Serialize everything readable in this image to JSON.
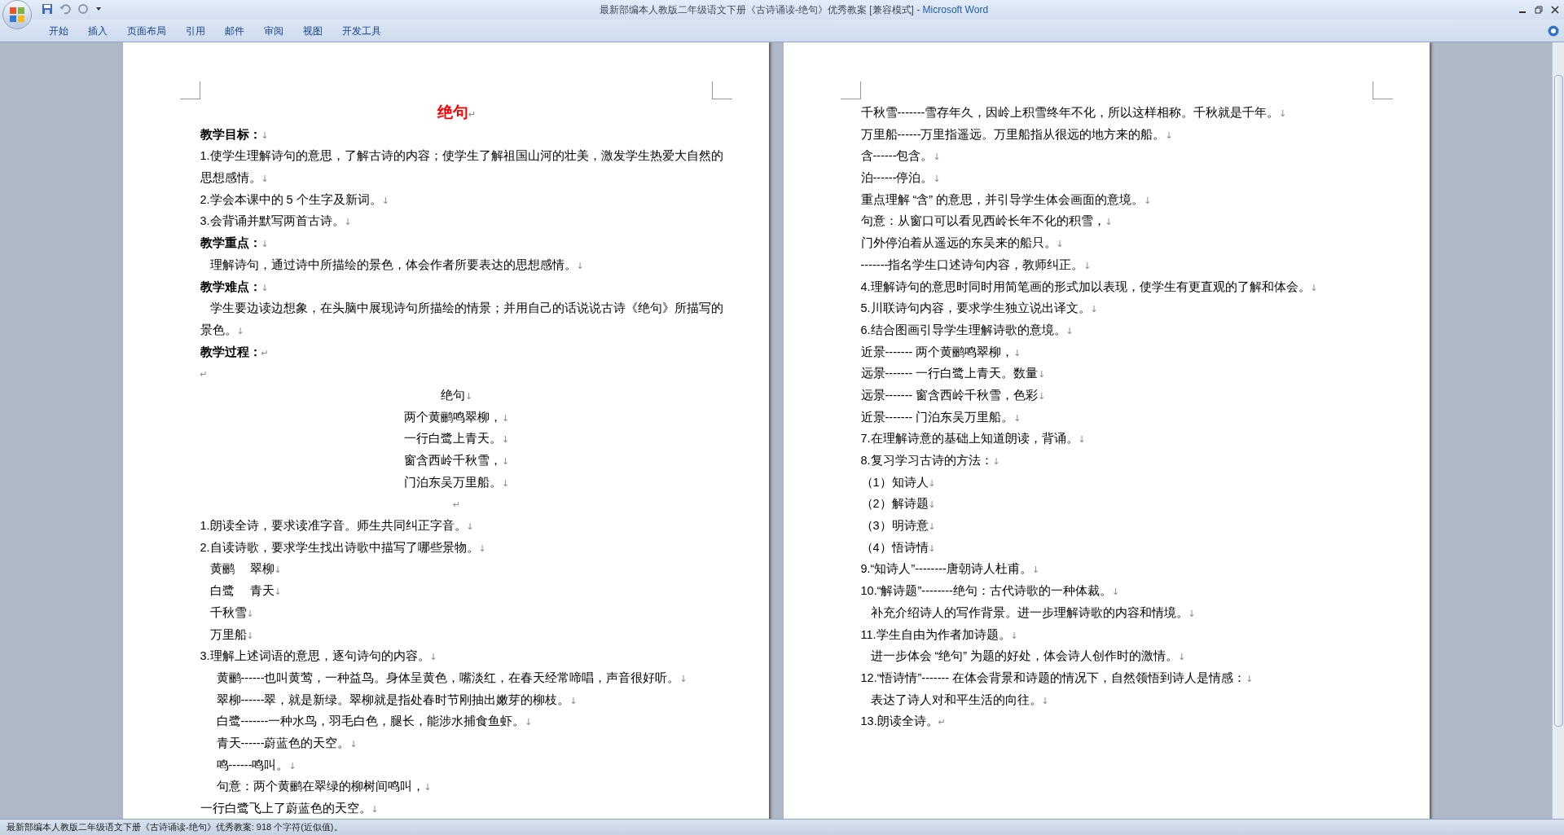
{
  "window": {
    "title": "最新部编本人教版二年级语文下册《古诗诵读-绝句》优秀教案 [兼容模式] - ",
    "app_name": "Microsoft Word"
  },
  "ribbon_tabs": [
    {
      "label": "开始",
      "selected": false
    },
    {
      "label": "插入",
      "selected": false
    },
    {
      "label": "页面布局",
      "selected": false
    },
    {
      "label": "引用",
      "selected": false
    },
    {
      "label": "邮件",
      "selected": false
    },
    {
      "label": "审阅",
      "selected": false
    },
    {
      "label": "视图",
      "selected": false
    },
    {
      "label": "开发工具",
      "selected": false
    }
  ],
  "pages": [
    {
      "lines": [
        {
          "kind": "title",
          "text": "绝句",
          "end": "↵"
        },
        {
          "kind": "heading",
          "text": "教学目标：",
          "end": "↓"
        },
        {
          "kind": "wrapped",
          "text": "1.使学生理解诗句的意思，了解古诗的内容；使学生了解祖国山河的壮美，激发学生热爱大自然的"
        },
        {
          "kind": "body",
          "text": "思想感情。",
          "end": "↓"
        },
        {
          "kind": "body",
          "text": "2.学会本课中的 5 个生字及新词。",
          "end": "↓"
        },
        {
          "kind": "body",
          "text": "3.会背诵并默写两首古诗。",
          "end": "↓"
        },
        {
          "kind": "heading",
          "text": "教学重点：",
          "end": "↓"
        },
        {
          "kind": "indent",
          "text": "理解诗句，通过诗中所描绘的景色，体会作者所要表达的思想感情。",
          "end": "↓"
        },
        {
          "kind": "heading",
          "text": "教学难点：",
          "end": "↓"
        },
        {
          "kind": "wrapped_indent",
          "text": "学生要边读边想象，在头脑中展现诗句所描绘的情景；并用自己的话说说古诗《绝句》所描写的"
        },
        {
          "kind": "body",
          "text": "景色。",
          "end": "↓"
        },
        {
          "kind": "heading",
          "text": "教学过程：",
          "end": "↵"
        },
        {
          "kind": "blank",
          "end": "↵"
        },
        {
          "kind": "center",
          "text": "绝句",
          "end": "↓"
        },
        {
          "kind": "center",
          "text": "两个黄鹂鸣翠柳，",
          "end": "↓"
        },
        {
          "kind": "center",
          "text": "一行白鹭上青天。",
          "end": "↓"
        },
        {
          "kind": "center",
          "text": "窗含西岭千秋雪，",
          "end": "↓"
        },
        {
          "kind": "center",
          "text": "门泊东吴万里船。",
          "end": "↓"
        },
        {
          "kind": "center_blank",
          "end": "↵"
        },
        {
          "kind": "body",
          "text": "1.朗读全诗，要求读准字音。师生共同纠正字音。",
          "end": "↓"
        },
        {
          "kind": "body",
          "text": "2.自读诗歌，要求学生找出诗歌中描写了哪些景物。",
          "end": "↓"
        },
        {
          "kind": "indent",
          "text": "黄鹂　 翠柳",
          "end": "↓"
        },
        {
          "kind": "indent",
          "text": "白鹭　 青天",
          "end": "↓"
        },
        {
          "kind": "indent",
          "text": "千秋雪",
          "end": "↓"
        },
        {
          "kind": "indent",
          "text": "万里船",
          "end": "↓"
        },
        {
          "kind": "body",
          "text": "3.理解上述词语的意思，逐句诗句的内容。",
          "end": "↓"
        },
        {
          "kind": "subitem",
          "text": "黄鹂------也叫黄莺，一种益鸟。身体呈黄色，嘴淡红，在春天经常啼唱，声音很好听。",
          "end": "↓"
        },
        {
          "kind": "subitem",
          "text": "翠柳------翠，就是新绿。翠柳就是指处春时节刚抽出嫩芽的柳枝。",
          "end": "↓"
        },
        {
          "kind": "subitem",
          "text": "白鹭-------一种水鸟，羽毛白色，腿长，能涉水捕食鱼虾。",
          "end": "↓"
        },
        {
          "kind": "subitem",
          "text": "青天------蔚蓝色的天空。",
          "end": "↓"
        },
        {
          "kind": "subitem",
          "text": "鸣------鸣叫。",
          "end": "↓"
        },
        {
          "kind": "subitem",
          "text": "句意：两个黄鹂在翠绿的柳树间鸣叫，",
          "end": "↓"
        },
        {
          "kind": "body",
          "text": "一行白鹭飞上了蔚蓝色的天空。",
          "end": "↓"
        }
      ]
    },
    {
      "lines": [
        {
          "kind": "body",
          "text": "千秋雪-------雪存年久，因岭上积雪终年不化，所以这样相称。千秋就是千年。",
          "end": "↓"
        },
        {
          "kind": "body",
          "text": "万里船------万里指遥远。万里船指从很远的地方来的船。",
          "end": "↓"
        },
        {
          "kind": "body",
          "text": "含------包含。",
          "end": "↓"
        },
        {
          "kind": "body",
          "text": "泊------停泊。",
          "end": "↓"
        },
        {
          "kind": "body",
          "text": "重点理解 “含” 的意思，并引导学生体会画面的意境。",
          "end": "↓"
        },
        {
          "kind": "body",
          "text": "句意：从窗口可以看见西岭长年不化的积雪，",
          "end": "↓"
        },
        {
          "kind": "body",
          "text": "门外停泊着从遥远的东吴来的船只。",
          "end": "↓"
        },
        {
          "kind": "body",
          "text": "-------指名学生口述诗句内容，教师纠正。",
          "end": "↓"
        },
        {
          "kind": "body",
          "text": "4.理解诗句的意思时同时用简笔画的形式加以表现，使学生有更直观的了解和体会。",
          "end": "↓"
        },
        {
          "kind": "body",
          "text": "5.川联诗句内容，要求学生独立说出译文。",
          "end": "↓"
        },
        {
          "kind": "body",
          "text": "6.结合图画引导学生理解诗歌的意境。",
          "end": "↓"
        },
        {
          "kind": "body",
          "text": "近景------- 两个黄鹂鸣翠柳，",
          "end": "↓"
        },
        {
          "kind": "body",
          "text": "远景------- 一行白鹭上青天。数量",
          "end": "↓"
        },
        {
          "kind": "body",
          "text": "远景------- 窗含西岭千秋雪，色彩",
          "end": "↓"
        },
        {
          "kind": "body",
          "text": "近景------- 门泊东吴万里船。",
          "end": "↓"
        },
        {
          "kind": "body",
          "text": "7.在理解诗意的基础上知道朗读，背诵。",
          "end": "↓"
        },
        {
          "kind": "body",
          "text": "8.复习学习古诗的方法：",
          "end": "↓"
        },
        {
          "kind": "body",
          "text": "（1）知诗人",
          "end": "↓"
        },
        {
          "kind": "body",
          "text": "（2）解诗题",
          "end": "↓"
        },
        {
          "kind": "body",
          "text": "（3）明诗意",
          "end": "↓"
        },
        {
          "kind": "body",
          "text": "（4）悟诗情",
          "end": "↓"
        },
        {
          "kind": "body",
          "text": "9.“知诗人”--------唐朝诗人杜甫。",
          "end": "↓"
        },
        {
          "kind": "body",
          "text": "10.“解诗题”--------绝句：古代诗歌的一种体裁。",
          "end": "↓"
        },
        {
          "kind": "indent",
          "text": "补充介绍诗人的写作背景。进一步理解诗歌的内容和情境。",
          "end": "↓"
        },
        {
          "kind": "body",
          "text": "11.学生自由为作者加诗题。",
          "end": "↓"
        },
        {
          "kind": "indent",
          "text": "进一步体会 “绝句” 为题的好处，体会诗人创作时的激情。",
          "end": "↓"
        },
        {
          "kind": "body",
          "text": "12.“悟诗情”------- 在体会背景和诗题的情况下，自然领悟到诗人是情感：",
          "end": "↓"
        },
        {
          "kind": "indent",
          "text": "表达了诗人对和平生活的向往。",
          "end": "↓"
        },
        {
          "kind": "body",
          "text": "13.朗读全诗。",
          "end": "↵"
        }
      ]
    }
  ],
  "status_bar": {
    "text": "最新部编本人教版二年级语文下册《古诗诵读-绝句》优秀教案: 918 个字符(近似值)。"
  }
}
